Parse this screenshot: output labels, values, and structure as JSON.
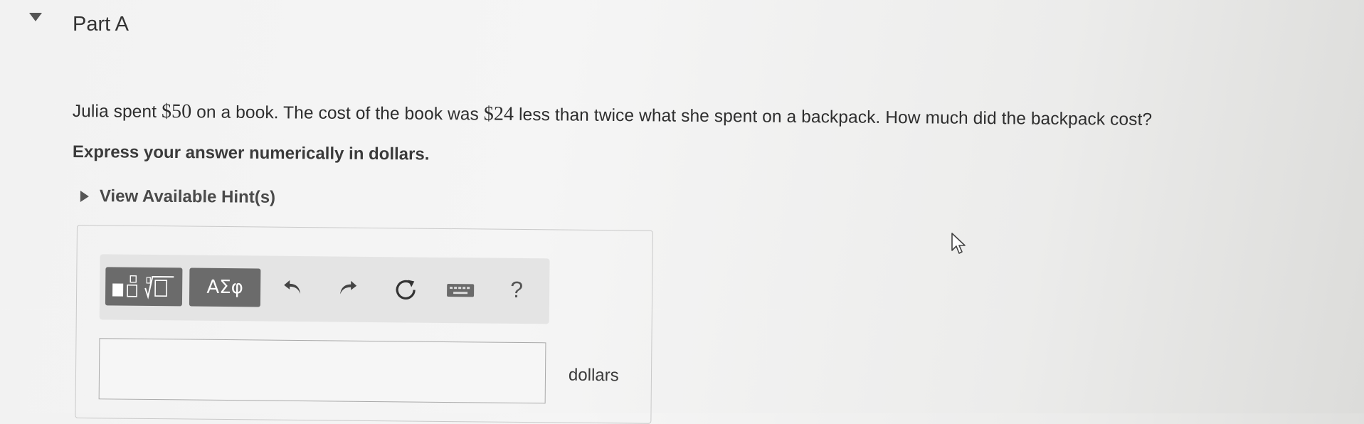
{
  "part": {
    "title": "Part A",
    "toggle_icon": "triangle-down-icon"
  },
  "question": {
    "text_before_1": "Julia spent ",
    "amount_1": "$50",
    "text_between": " on a book. The cost of the book was ",
    "amount_2": "$24",
    "text_after": " less than twice what she spent on a backpack. How much did the backpack cost?"
  },
  "instruction": "Express your answer numerically in dollars.",
  "hints": {
    "label": "View Available Hint(s)",
    "icon": "triangle-right-icon"
  },
  "toolbar": {
    "templates_icon": "templates-icon",
    "symbols_label": "ΑΣφ",
    "undo_icon": "undo-icon",
    "redo_icon": "redo-icon",
    "reset_icon": "reset-icon",
    "keyboard_icon": "keyboard-icon",
    "help_label": "?"
  },
  "answer": {
    "value": "",
    "unit": "dollars"
  },
  "colors": {
    "toolbar_bg": "#e4e4e4",
    "dark_button": "#6b6b6b",
    "panel_border": "#c9c9c9"
  }
}
